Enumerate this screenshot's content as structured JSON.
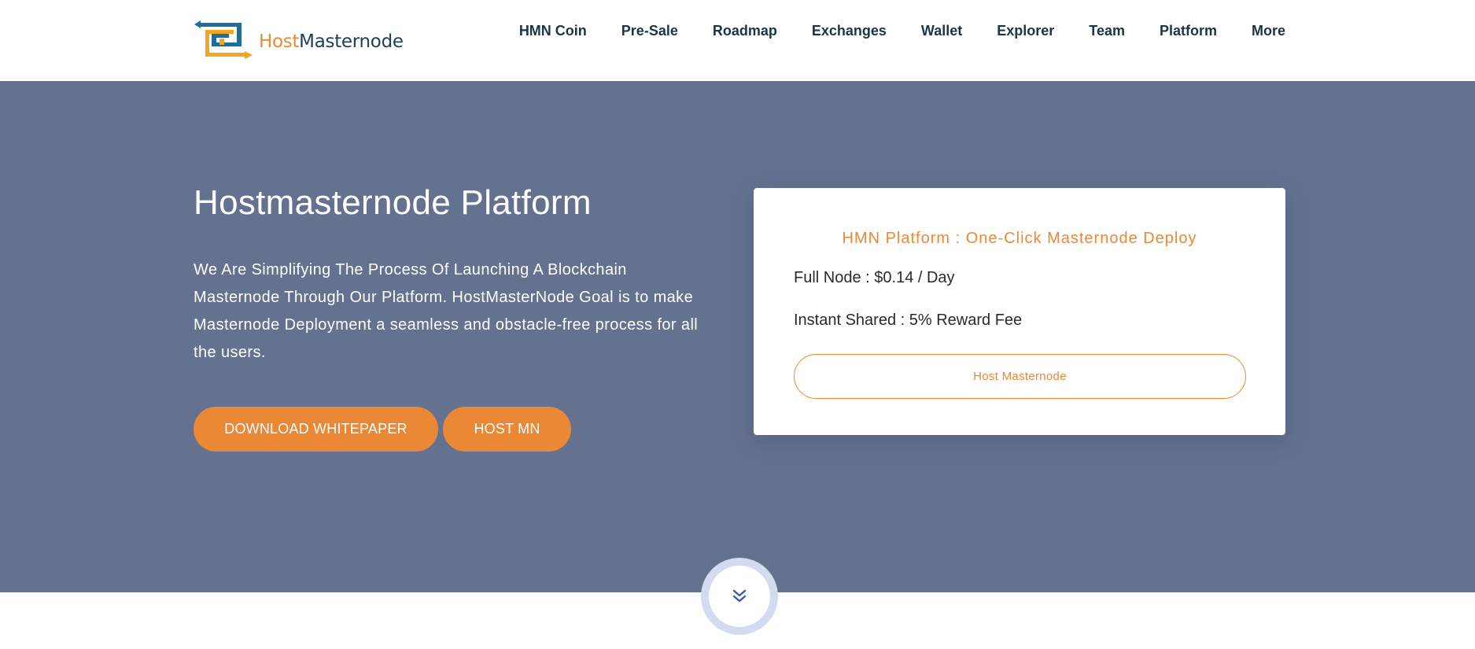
{
  "header": {
    "logo": {
      "text_host": "Host",
      "text_master": "Masternode",
      "icon": "hmn-logo-icon"
    },
    "nav": [
      {
        "label": "HMN Coin"
      },
      {
        "label": "Pre-Sale"
      },
      {
        "label": "Roadmap"
      },
      {
        "label": "Exchanges"
      },
      {
        "label": "Wallet"
      },
      {
        "label": "Explorer"
      },
      {
        "label": "Team"
      },
      {
        "label": "Platform"
      },
      {
        "label": "More"
      }
    ]
  },
  "hero": {
    "title": "Hostmasternode Platform",
    "description": "We Are Simplifying The Process Of Launching A Blockchain Masternode Through Our Platform. HostMasterNode Goal is to make Masternode Deployment a seamless and obstacle-free process for all the users.",
    "buttons": {
      "whitepaper": "DOWNLOAD WHITEPAPER",
      "host_mn": "HOST MN"
    },
    "card": {
      "title": "HMN Platform : One-Click Masternode Deploy",
      "line1": "Full Node : $0.14 / Day",
      "line2": "Instant Shared : 5% Reward Fee",
      "button": "Host Masternode"
    },
    "scroll_icon": "chevron-double-down-icon"
  },
  "colors": {
    "accent": "#ea8836",
    "hero_bg": "#647290",
    "nav_text": "#1b3447",
    "scroll_ring": "#d3dbf1"
  }
}
